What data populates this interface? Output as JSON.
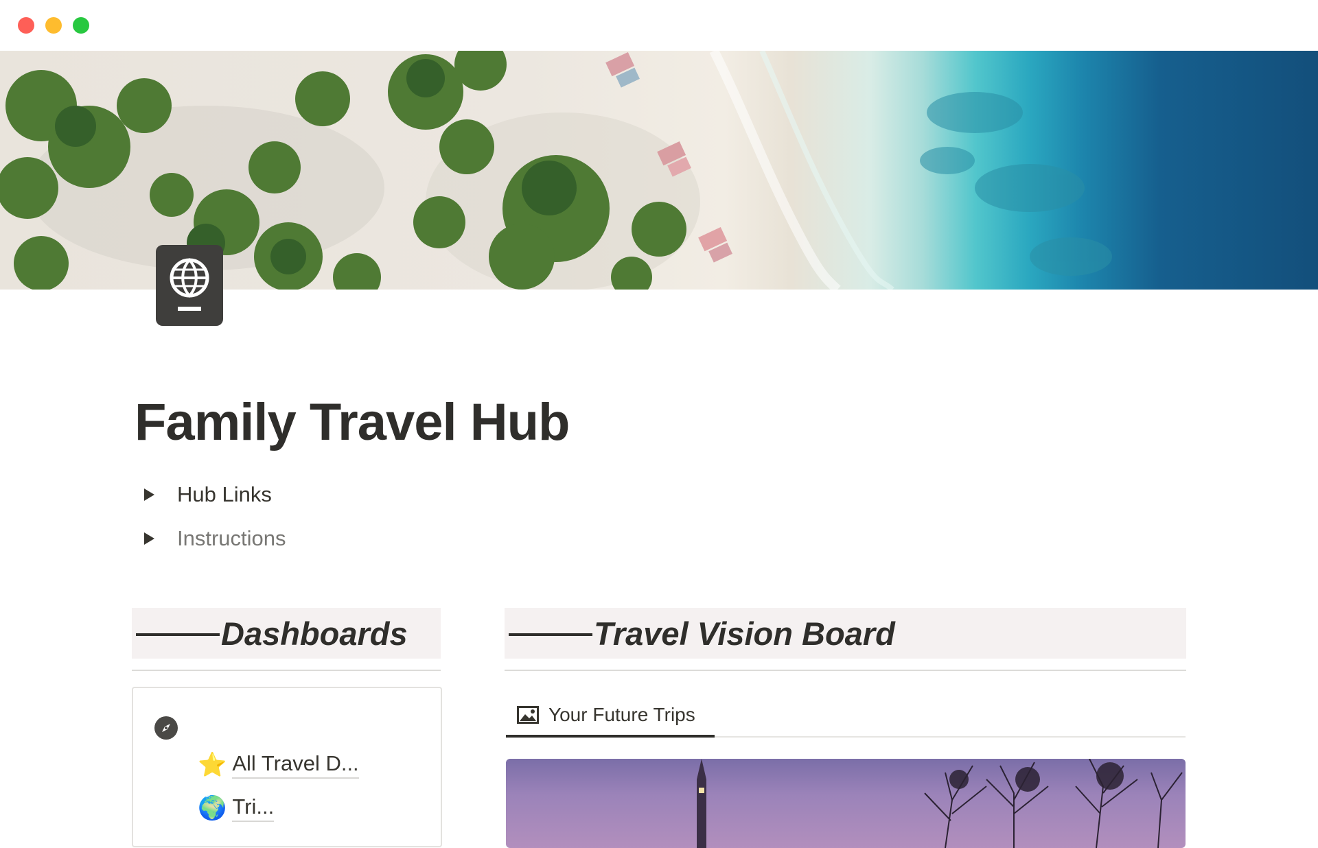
{
  "window": {
    "controls": [
      "close",
      "minimize",
      "zoom"
    ]
  },
  "cover": {
    "description_icon": "beach-cover-image"
  },
  "page": {
    "icon": "passport-icon",
    "title": "Family Travel Hub"
  },
  "toggles": [
    {
      "label": "Hub Links"
    },
    {
      "label": "Instructions"
    }
  ],
  "sections": {
    "dashboards": {
      "dash": "",
      "title": "Dashboards",
      "card": {
        "icon": "compass-icon",
        "links": [
          {
            "emoji": "⭐",
            "label": "All Travel D..."
          },
          {
            "emoji": "🌍",
            "label": "Tri..."
          }
        ]
      }
    },
    "vision_board": {
      "title": "Travel Vision Board",
      "tabs": [
        {
          "icon": "image-icon",
          "label": "Your Future Trips"
        }
      ]
    }
  },
  "colors": {
    "heading_bg": "#f5f1f1",
    "text": "#37352f",
    "muted_text": "#787774",
    "traffic_red": "#fe5f57",
    "traffic_yellow": "#febc2e",
    "traffic_green": "#28c840"
  }
}
